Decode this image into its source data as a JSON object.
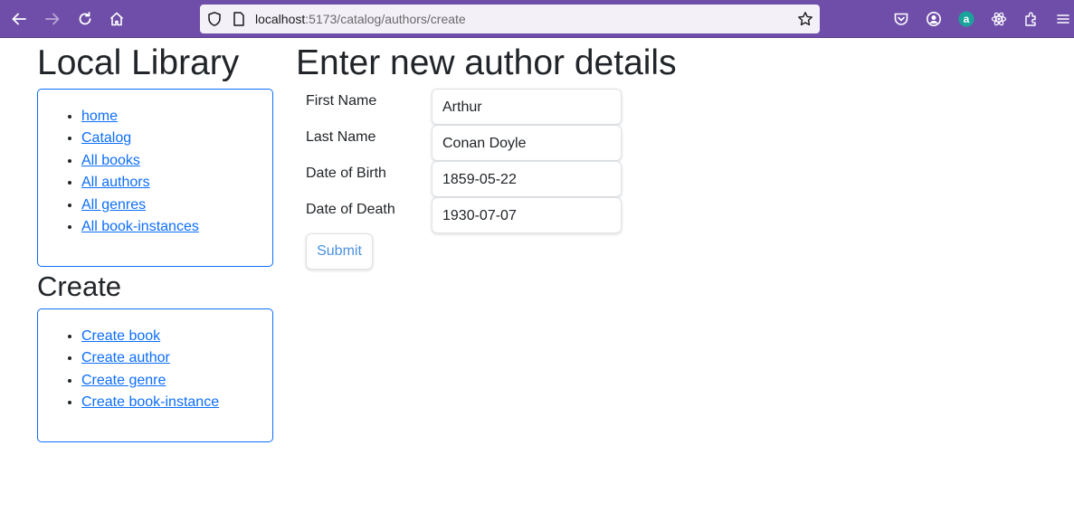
{
  "browser": {
    "url_host": "localhost",
    "url_path": ":5173/catalog/authors/create",
    "icons": [
      "back-icon",
      "forward-icon",
      "reload-icon",
      "home-icon",
      "shield-icon",
      "page-icon",
      "star-icon",
      "pocket-icon",
      "account-icon",
      "extension-a-icon",
      "react-icon",
      "extensions-icon",
      "menu-icon"
    ],
    "toolbar_color": "#6f4ea9"
  },
  "sidebar": {
    "title": "Local Library",
    "nav_items": [
      "home",
      "Catalog",
      "All books",
      "All authors",
      "All genres",
      "All book-instances"
    ],
    "create_title": "Create",
    "create_items": [
      "Create book",
      "Create author",
      "Create genre",
      "Create book-instance"
    ]
  },
  "form": {
    "title": "Enter new author details",
    "fields": [
      {
        "label": "First Name",
        "value": "Arthur"
      },
      {
        "label": "Last Name",
        "value": "Conan Doyle"
      },
      {
        "label": "Date of Birth",
        "value": "1859-05-22"
      },
      {
        "label": "Date of Death",
        "value": "1930-07-07"
      }
    ],
    "submit_label": "Submit"
  },
  "colors": {
    "link": "#0d6efd",
    "submit_text": "#4a90e2"
  }
}
